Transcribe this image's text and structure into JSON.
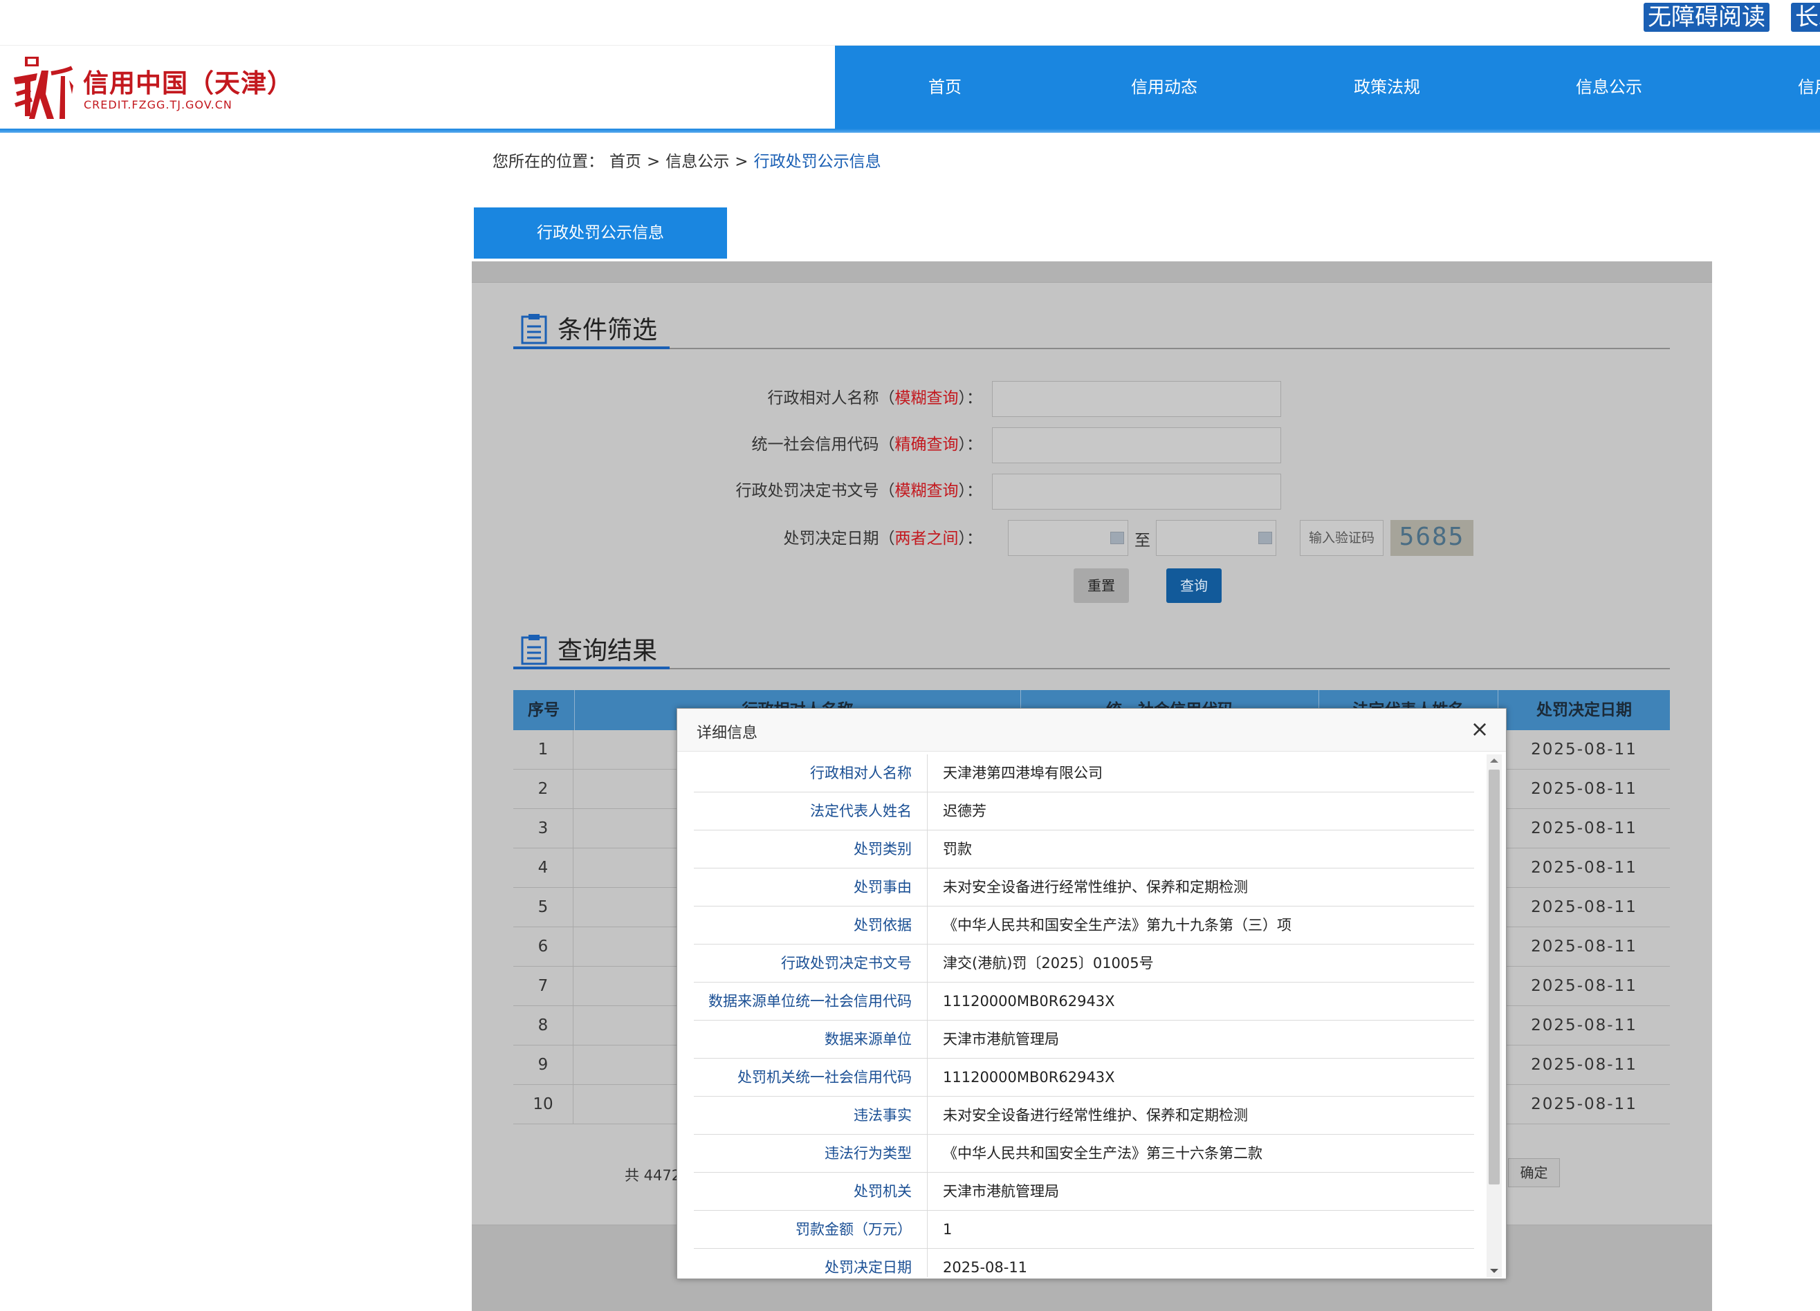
{
  "topbar": {
    "accessibility_btn": "无障碍阅读",
    "elder_btn": "长辈"
  },
  "site": {
    "name_cn": "信用中国（天津）",
    "name_en": "CREDIT.FZGG.TJ.GOV.CN"
  },
  "nav": {
    "items": [
      "首页",
      "信用动态",
      "政策法规",
      "信息公示",
      "信用"
    ]
  },
  "breadcrumb": {
    "prefix": "您所在的位置：",
    "home": "首页",
    "sep": ">",
    "level2": "信息公示",
    "current": "行政处罚公示信息"
  },
  "tab": {
    "label": "行政处罚公示信息"
  },
  "filter": {
    "title": "条件筛选",
    "fields": [
      {
        "label": "行政相对人名称",
        "hint": "模糊查询"
      },
      {
        "label": "统一社会信用代码",
        "hint": "精确查询"
      },
      {
        "label": "行政处罚决定书文号",
        "hint": "模糊查询"
      },
      {
        "label": "处罚决定日期",
        "hint": "两者之间"
      }
    ],
    "paren_open": "（",
    "paren_close": "）：",
    "date_to": "至",
    "captcha_placeholder": "输入验证码",
    "captcha_code": "5685",
    "reset_btn": "重置",
    "search_btn": "查询"
  },
  "results": {
    "title": "查询结果",
    "columns": [
      "序号",
      "行政相对人名称",
      "统一社会信用代码",
      "法定代表人姓名",
      "处罚决定日期"
    ],
    "rows": [
      {
        "no": "1",
        "date": "2025-08-11"
      },
      {
        "no": "2",
        "date": "2025-08-11"
      },
      {
        "no": "3",
        "date": "2025-08-11"
      },
      {
        "no": "4",
        "date": "2025-08-11"
      },
      {
        "no": "5",
        "date": "2025-08-11"
      },
      {
        "no": "6",
        "date": "2025-08-11"
      },
      {
        "no": "7",
        "date": "2025-08-11"
      },
      {
        "no": "8",
        "date": "2025-08-11"
      },
      {
        "no": "9",
        "date": "2025-08-11"
      },
      {
        "no": "10",
        "date": "2025-08-11"
      }
    ],
    "pager_total": "共 4472",
    "pager_ok": "确定"
  },
  "modal": {
    "title": "详细信息",
    "close": "×",
    "rows": [
      {
        "label": "行政相对人名称",
        "value": "天津港第四港埠有限公司"
      },
      {
        "label": "法定代表人姓名",
        "value": "迟德芳"
      },
      {
        "label": "处罚类别",
        "value": "罚款"
      },
      {
        "label": "处罚事由",
        "value": "未对安全设备进行经常性维护、保养和定期检测"
      },
      {
        "label": "处罚依据",
        "value": "《中华人民共和国安全生产法》第九十九条第（三）项"
      },
      {
        "label": "行政处罚决定书文号",
        "value": "津交(港航)罚〔2025〕01005号"
      },
      {
        "label": "数据来源单位统一社会信用代码",
        "value": "11120000MB0R62943X"
      },
      {
        "label": "数据来源单位",
        "value": "天津市港航管理局"
      },
      {
        "label": "处罚机关统一社会信用代码",
        "value": "11120000MB0R62943X"
      },
      {
        "label": "违法事实",
        "value": "未对安全设备进行经常性维护、保养和定期检测"
      },
      {
        "label": "违法行为类型",
        "value": "《中华人民共和国安全生产法》第三十六条第二款"
      },
      {
        "label": "处罚机关",
        "value": "天津市港航管理局"
      },
      {
        "label": "罚款金额（万元）",
        "value": "1"
      },
      {
        "label": "处罚决定日期",
        "value": "2025-08-11"
      }
    ]
  },
  "colors": {
    "brand_red": "#c3181e",
    "nav_blue": "#1a86e0",
    "link_blue": "#1a5fb4"
  },
  "icons": {
    "filter_section": "clipboard-icon",
    "results_section": "clipboard-icon",
    "calendar": "calendar-icon",
    "close": "close-icon"
  }
}
